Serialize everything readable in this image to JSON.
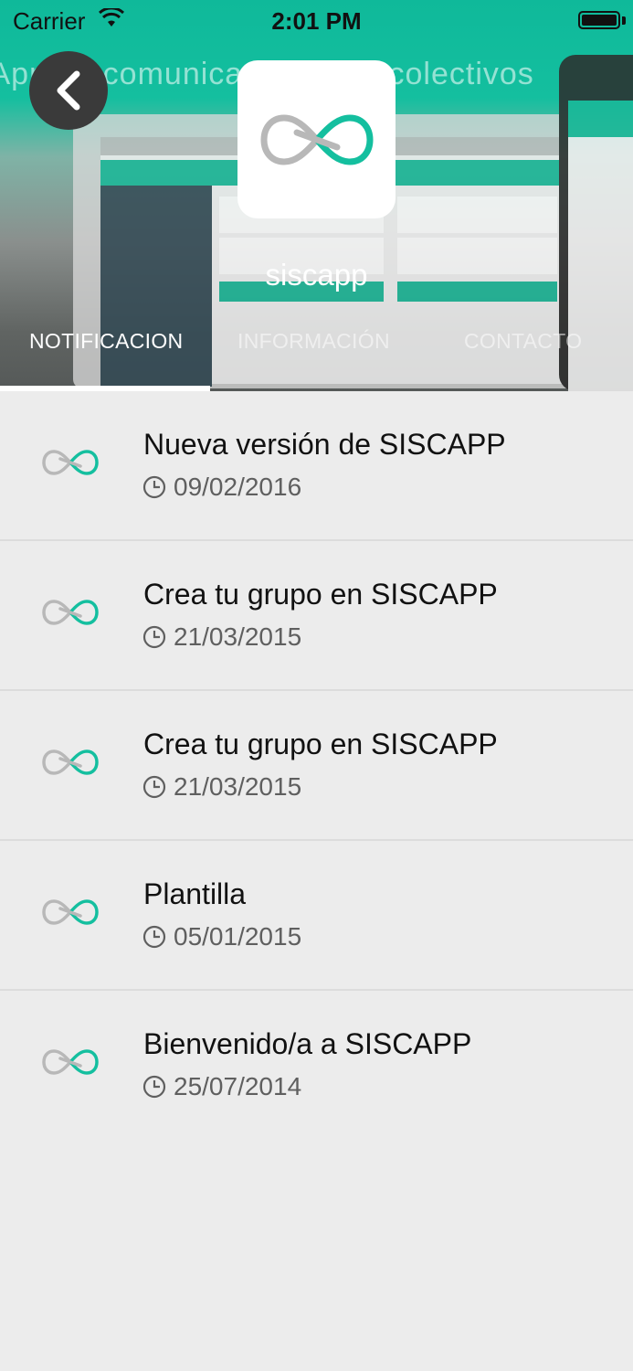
{
  "status_bar": {
    "carrier": "Carrier",
    "time": "2:01 PM"
  },
  "hero": {
    "banner_text": "a App de comunicación para colectivos"
  },
  "app": {
    "name": "siscapp"
  },
  "tabs": [
    {
      "label": "NOTIFICACION",
      "active": true
    },
    {
      "label": "INFORMACIÓN",
      "active": false
    },
    {
      "label": "CONTACTO",
      "active": false
    }
  ],
  "notifications": [
    {
      "title": "Nueva versión de SISCAPP",
      "date": "09/02/2016"
    },
    {
      "title": "Crea tu grupo en SISCAPP",
      "date": "21/03/2015"
    },
    {
      "title": "Crea tu grupo en SISCAPP",
      "date": "21/03/2015"
    },
    {
      "title": "Plantilla",
      "date": "05/01/2015"
    },
    {
      "title": "Bienvenido/a a SISCAPP",
      "date": "25/07/2014"
    }
  ],
  "colors": {
    "brand": "#14bf9f",
    "logo_gray": "#b8b8b8"
  }
}
